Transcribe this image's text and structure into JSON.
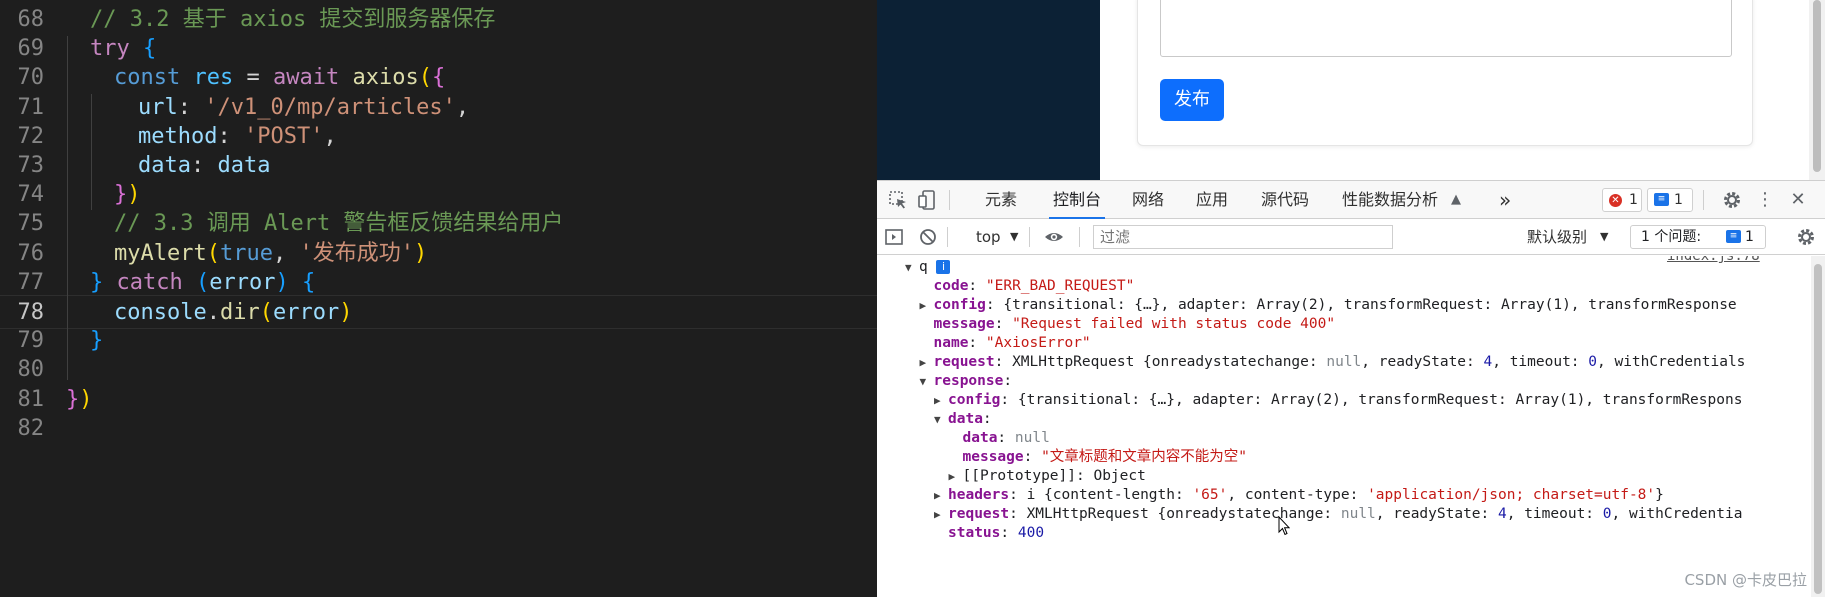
{
  "editor": {
    "lines": [
      {
        "num": "68",
        "tokens": [
          {
            "t": "// 3.2 基于 axios 提交到服务器保存",
            "c": "t-comment"
          }
        ]
      },
      {
        "num": "69",
        "tokens": [
          {
            "t": "try",
            "c": "t-kw"
          },
          {
            "t": " ",
            "c": "t-plain"
          },
          {
            "t": "{",
            "c": "t-b3"
          }
        ]
      },
      {
        "num": "70",
        "tokens": [
          {
            "t": "const",
            "c": "t-storage"
          },
          {
            "t": " ",
            "c": "t-plain"
          },
          {
            "t": "res",
            "c": "t-var"
          },
          {
            "t": " = ",
            "c": "t-plain"
          },
          {
            "t": "await",
            "c": "t-kw"
          },
          {
            "t": " ",
            "c": "t-plain"
          },
          {
            "t": "axios",
            "c": "t-fn"
          },
          {
            "t": "(",
            "c": "t-b1"
          },
          {
            "t": "{",
            "c": "t-b2"
          }
        ]
      },
      {
        "num": "71",
        "tokens": [
          {
            "t": "url",
            "c": "t-param"
          },
          {
            "t": ": ",
            "c": "t-plain"
          },
          {
            "t": "'/v1_0/mp/articles'",
            "c": "t-str"
          },
          {
            "t": ",",
            "c": "t-plain"
          }
        ]
      },
      {
        "num": "72",
        "tokens": [
          {
            "t": "method",
            "c": "t-param"
          },
          {
            "t": ": ",
            "c": "t-plain"
          },
          {
            "t": "'POST'",
            "c": "t-str"
          },
          {
            "t": ",",
            "c": "t-plain"
          }
        ]
      },
      {
        "num": "73",
        "tokens": [
          {
            "t": "data",
            "c": "t-param"
          },
          {
            "t": ": ",
            "c": "t-plain"
          },
          {
            "t": "data",
            "c": "t-param"
          }
        ]
      },
      {
        "num": "74",
        "tokens": [
          {
            "t": "}",
            "c": "t-b2"
          },
          {
            "t": ")",
            "c": "t-b1"
          }
        ]
      },
      {
        "num": "75",
        "tokens": [
          {
            "t": "// 3.3 调用 Alert 警告框反馈结果给用户",
            "c": "t-comment"
          }
        ]
      },
      {
        "num": "76",
        "tokens": [
          {
            "t": "myAlert",
            "c": "t-fn"
          },
          {
            "t": "(",
            "c": "t-b1"
          },
          {
            "t": "true",
            "c": "t-storage"
          },
          {
            "t": ", ",
            "c": "t-plain"
          },
          {
            "t": "'发布成功'",
            "c": "t-str"
          },
          {
            "t": ")",
            "c": "t-b1"
          }
        ]
      },
      {
        "num": "77",
        "tokens": [
          {
            "t": "}",
            "c": "t-b3"
          },
          {
            "t": " ",
            "c": "t-plain"
          },
          {
            "t": "catch",
            "c": "t-kw"
          },
          {
            "t": " ",
            "c": "t-plain"
          },
          {
            "t": "(",
            "c": "t-b3"
          },
          {
            "t": "error",
            "c": "t-param"
          },
          {
            "t": ")",
            "c": "t-b3"
          },
          {
            "t": " ",
            "c": "t-plain"
          },
          {
            "t": "{",
            "c": "t-b3"
          }
        ]
      },
      {
        "num": "78",
        "tokens": [
          {
            "t": "console",
            "c": "t-param"
          },
          {
            "t": ".",
            "c": "t-plain"
          },
          {
            "t": "dir",
            "c": "t-fn"
          },
          {
            "t": "(",
            "c": "t-b1"
          },
          {
            "t": "error",
            "c": "t-param"
          },
          {
            "t": ")",
            "c": "t-b1"
          }
        ]
      },
      {
        "num": "79",
        "tokens": [
          {
            "t": "}",
            "c": "t-b3"
          }
        ]
      },
      {
        "num": "80",
        "tokens": []
      },
      {
        "num": "81",
        "tokens": [
          {
            "t": "}",
            "c": "t-b2"
          },
          {
            "t": ")",
            "c": "t-b1"
          }
        ]
      },
      {
        "num": "82",
        "tokens": []
      }
    ]
  },
  "page": {
    "publish_label": "发布"
  },
  "devtools": {
    "tabs": [
      "元素",
      "控制台",
      "网络",
      "应用",
      "源代码",
      "性能数据分析"
    ],
    "more_label": "»",
    "error_count": "1",
    "message_count": "1",
    "context_label": "top",
    "filter_placeholder": "过滤",
    "level_label": "默认级别",
    "issues_label": "1 个问题:",
    "issues_count": "1",
    "file_ref": "index.js:78",
    "console_rows": [
      {
        "indent": 0,
        "tri": "▼",
        "html": "q"
      },
      {
        "indent": 1,
        "tri": "",
        "key": "code",
        "val": [
          {
            "t": "\"ERR_BAD_REQUEST\"",
            "c": "s"
          }
        ]
      },
      {
        "indent": 1,
        "tri": "▶",
        "key": "config",
        "val": [
          {
            "t": "{transitional: {…}, adapter: Array(2), transformRequest: Array(1), transformResponse",
            "c": ""
          }
        ]
      },
      {
        "indent": 1,
        "tri": "",
        "key": "message",
        "val": [
          {
            "t": "\"Request failed with status code 400\"",
            "c": "s"
          }
        ]
      },
      {
        "indent": 1,
        "tri": "",
        "key": "name",
        "val": [
          {
            "t": "\"AxiosError\"",
            "c": "s"
          }
        ]
      },
      {
        "indent": 1,
        "tri": "▶",
        "key": "request",
        "val": [
          {
            "t": "XMLHttpRequest {onreadystatechange: ",
            "c": ""
          },
          {
            "t": "null",
            "c": "nl"
          },
          {
            "t": ", readyState: ",
            "c": ""
          },
          {
            "t": "4",
            "c": "n"
          },
          {
            "t": ", timeout: ",
            "c": ""
          },
          {
            "t": "0",
            "c": "n"
          },
          {
            "t": ", withCredentials",
            "c": ""
          }
        ]
      },
      {
        "indent": 1,
        "tri": "▼",
        "key": "response",
        "val": []
      },
      {
        "indent": 2,
        "tri": "▶",
        "key": "config",
        "val": [
          {
            "t": "{transitional: {…}, adapter: Array(2), transformRequest: Array(1), transformRespons",
            "c": ""
          }
        ]
      },
      {
        "indent": 2,
        "tri": "▼",
        "key": "data",
        "val": []
      },
      {
        "indent": 3,
        "tri": "",
        "key": "data",
        "val": [
          {
            "t": "null",
            "c": "nl"
          }
        ]
      },
      {
        "indent": 3,
        "tri": "",
        "key": "message",
        "val": [
          {
            "t": "\"文章标题和文章内容不能为空\"",
            "c": "s"
          }
        ]
      },
      {
        "indent": 3,
        "tri": "▶",
        "key": "[[Prototype]]",
        "plainkey": true,
        "val": [
          {
            "t": "Object",
            "c": ""
          }
        ]
      },
      {
        "indent": 2,
        "tri": "▶",
        "key": "headers",
        "val": [
          {
            "t": "i {content-length: ",
            "c": ""
          },
          {
            "t": "'65'",
            "c": "s"
          },
          {
            "t": ", content-type: ",
            "c": ""
          },
          {
            "t": "'application/json; charset=utf-8'",
            "c": "s"
          },
          {
            "t": "}",
            "c": ""
          }
        ]
      },
      {
        "indent": 2,
        "tri": "▶",
        "key": "request",
        "val": [
          {
            "t": "XMLHttpRequest {onreadystatechange: ",
            "c": ""
          },
          {
            "t": "null",
            "c": "nl"
          },
          {
            "t": ", readyState: ",
            "c": ""
          },
          {
            "t": "4",
            "c": "n"
          },
          {
            "t": ", timeout: ",
            "c": ""
          },
          {
            "t": "0",
            "c": "n"
          },
          {
            "t": ", withCredentia",
            "c": ""
          }
        ]
      },
      {
        "indent": 2,
        "tri": "",
        "key": "status",
        "val": [
          {
            "t": "400",
            "c": "n"
          }
        ]
      }
    ],
    "watermark": "CSDN @卡皮巴拉"
  },
  "colors": {
    "accent": "#1a73e8",
    "publish_button": "#0d6efd",
    "sidebar_dark": "#0c2135"
  }
}
